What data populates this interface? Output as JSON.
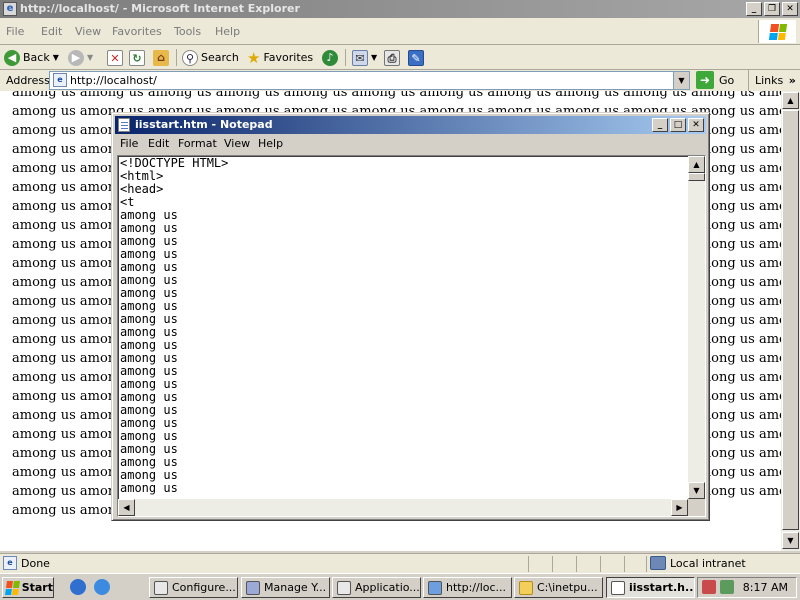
{
  "browser": {
    "title": "http://localhost/ - Microsoft Internet Explorer",
    "menu": [
      "File",
      "Edit",
      "View",
      "Favorites",
      "Tools",
      "Help"
    ],
    "toolbar": {
      "back": "Back",
      "search": "Search",
      "favorites": "Favorites"
    },
    "address_label": "Address",
    "address_value": "http://localhost/",
    "go_label": "Go",
    "links_label": "Links",
    "content_line_text": "among us among us among us among us among us among us among us among us among us among us among us among us among us",
    "content_last_line": "among us among us among us among us among us among us among us among us among us among us",
    "status": "Done",
    "zone": "Local intranet"
  },
  "notepad": {
    "title": "iisstart.htm - Notepad",
    "menu": [
      "File",
      "Edit",
      "Format",
      "View",
      "Help"
    ],
    "text": "<!DOCTYPE HTML>\n<html>\n<head>\n<t\namong us\namong us\namong us\namong us\namong us\namong us\namong us\namong us\namong us\namong us\namong us\namong us\namong us\namong us\namong us\namong us\namong us\namong us\namong us\namong us\namong us\namong us\namong us\namong us\namong us"
  },
  "taskbar": {
    "start": "Start",
    "tasks": [
      "Configure...",
      "Manage Y...",
      "Applicatio...",
      "http://loc...",
      "C:\\inetpu...",
      "iisstart.h..."
    ],
    "clock": "8:17 AM"
  },
  "icons": {
    "back": "back-arrow-icon",
    "forward": "forward-arrow-icon",
    "stop": "stop-icon",
    "refresh": "refresh-icon",
    "home": "home-icon",
    "search": "search-icon",
    "favorites": "favorites-star-icon",
    "media": "media-icon",
    "mail": "mail-icon",
    "print": "print-icon",
    "edit": "edit-icon"
  },
  "colors": {
    "ie_titlebar": "#8a8a8a",
    "notepad_titlebar": "#0a246a",
    "chrome": "#ece9d8",
    "classic": "#d4d0c8"
  }
}
